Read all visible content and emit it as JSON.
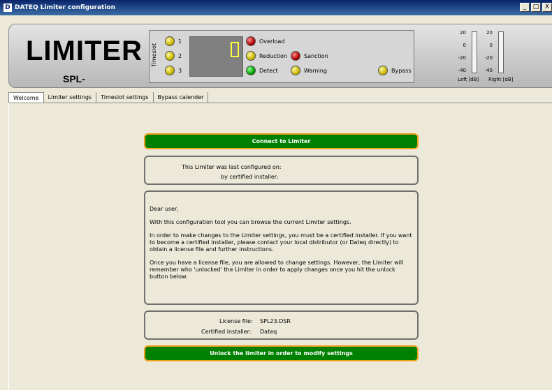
{
  "window": {
    "title": "DATEQ Limiter configuration",
    "app_icon": "D",
    "minimize": "_",
    "maximize": "□",
    "close": "X"
  },
  "header": {
    "logo_title": "LIMITER",
    "logo_sub": "SPL-",
    "timeslot_label": "Timeslot",
    "timeslots": [
      "1",
      "2",
      "3"
    ],
    "display_digit": "0",
    "indicators": {
      "overload": "Overload",
      "reduction": "Reduction",
      "sanction": "Sanction",
      "detect": "Detect",
      "warning": "Warning",
      "bypass": "Bypass"
    },
    "meters": {
      "scale": [
        "20",
        "0",
        "-20",
        "-40"
      ],
      "left_label": "Left [dB]",
      "right_label": "Right [dB]"
    }
  },
  "tabs": [
    "Welcome",
    "Limiter settings",
    "Timeslot settings",
    "Bypass calender"
  ],
  "welcome": {
    "connect_button": "Connect to Limiter",
    "config_label": "This Limiter was last configured on:",
    "installer_label": "by certified installer:",
    "message": [
      "Dear user,",
      "With this configuration tool you can browse the current Limiter settings.",
      "In order to make changes to the Limiter settings, you must be a certified installer. If you want to become a certified installer, please contact your local distributor (or Dateq directly) to obtain a license file and further instructions.",
      "Once you have a license file, you are allowed to change settings. However, the Limiter will remember who 'unlocked' the Limiter in order to apply changes once you hit the unlock button below."
    ],
    "license_file_label": "License file:",
    "license_file_value": "SPL23.DSR",
    "certified_installer_label": "Certified installer:",
    "certified_installer_value": "Dateq",
    "unlock_button": "Unlock the limiter in order to modify settings"
  }
}
